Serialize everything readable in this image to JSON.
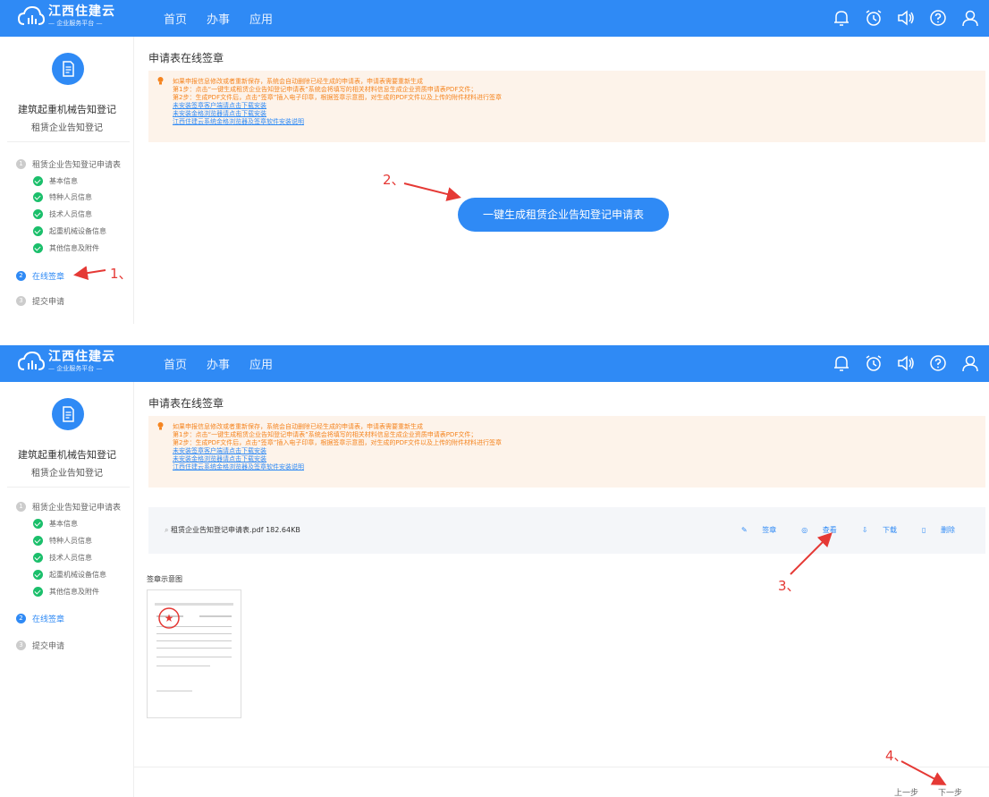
{
  "app": {
    "name": "江西住建云",
    "subtitle": "— 企业服务平台 —"
  },
  "nav": [
    "首页",
    "办事",
    "应用"
  ],
  "topbar_icons": [
    "bell-icon",
    "alarm-clock-icon",
    "speaker-icon",
    "help-icon",
    "user-icon"
  ],
  "sidebar": {
    "title": "建筑起重机械告知登记",
    "subtitle": "租赁企业告知登记",
    "steps": [
      {
        "num": "1",
        "label": "租赁企业告知登记申请表",
        "state": "done"
      },
      {
        "num": "2",
        "label": "在线签章",
        "state": "active"
      },
      {
        "num": "3",
        "label": "提交申请",
        "state": "pending"
      }
    ],
    "substeps": [
      "基本信息",
      "特种人员信息",
      "技术人员信息",
      "起重机械设备信息",
      "其他信息及附件"
    ]
  },
  "page_title": "申请表在线签章",
  "notice": {
    "line1": "如果申报信息修改或者重新保存，系统会自动删除已经生成的申请表，申请表需要重新生成",
    "line2": "第1步：点击“一键生成租赁企业告知登记申请表”系统会将填写的相关材料信息生成企业资质申请表PDF文件；",
    "line3": "第2步：生成PDF文件后，点击“签章”插入电子印章，根据签章示意图，对生成的PDF文件以及上传的附件材料进行签章",
    "link1": "未安装签章客户端请点击下载安装",
    "link2": "未安装金格浏览器请点击下载安装",
    "link3": "江西住建云系统金格浏览器及签章软件安装说明"
  },
  "generate_button": "一键生成租赁企业告知登记申请表",
  "file": {
    "name": "租赁企业告知登记申请表.pdf",
    "size": "182.64KB",
    "actions": [
      "签章",
      "查看",
      "下载",
      "删除"
    ]
  },
  "seal_example_title": "签章示意图",
  "pager": {
    "prev": "上一步",
    "next": "下一步"
  },
  "annotations": [
    "1、",
    "2、",
    "3、",
    "4、"
  ],
  "colors": {
    "primary": "#2f8af5",
    "success": "#1bbf6b",
    "notice_bg": "#fdf3ea",
    "notice_text": "#f5841f",
    "annotation": "#e53935"
  }
}
